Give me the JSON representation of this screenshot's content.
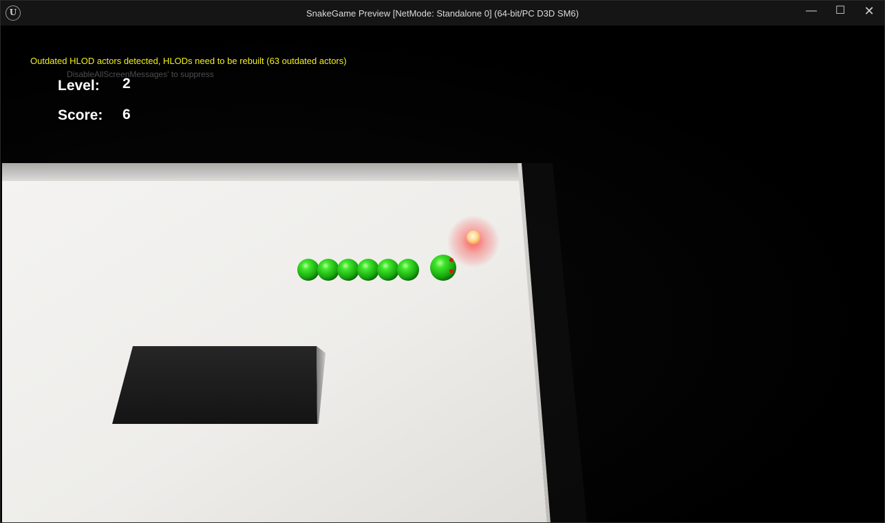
{
  "window": {
    "logo_glyph": "U",
    "title": "SnakeGame Preview [NetMode: Standalone 0]  (64-bit/PC D3D SM6)",
    "minimize_glyph": "—",
    "maximize_glyph": "☐",
    "close_glyph": "✕"
  },
  "viewport": {
    "warning_message": "Outdated HLOD actors detected, HLODs need to be rebuilt (63 outdated actors)",
    "suppress_hint": "DisableAllScreenMessages' to suppress",
    "warning_color": "#f2f21a"
  },
  "hud": {
    "level_label": "Level:",
    "level_value": "2",
    "score_label": "Score:",
    "score_value": "6"
  },
  "game": {
    "snake_color": "#2bd81e",
    "food_color": "#ffd58a",
    "snake_body_segments": 6
  }
}
